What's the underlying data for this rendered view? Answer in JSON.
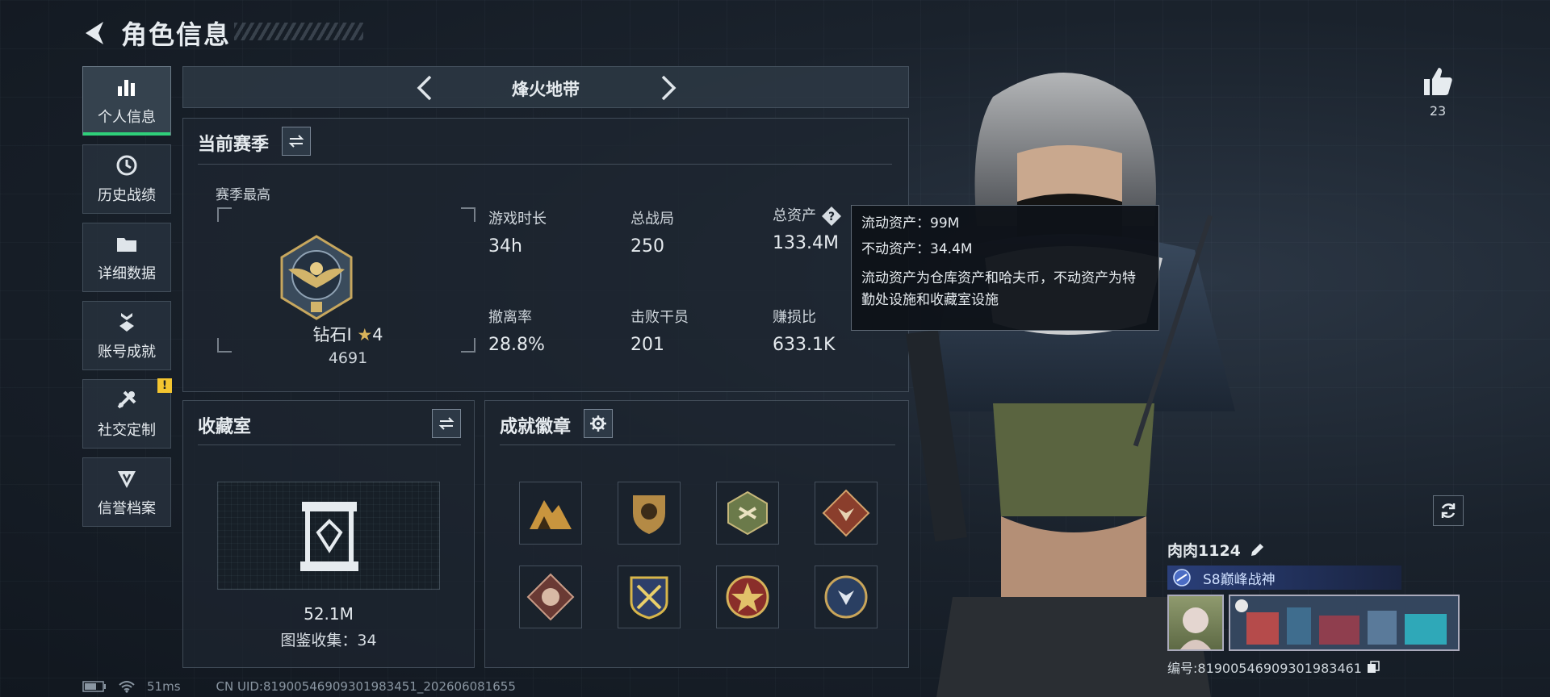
{
  "header": {
    "title": "角色信息"
  },
  "sidebar": {
    "items": [
      {
        "label": "个人信息",
        "icon": "bar-chart-icon",
        "active": true
      },
      {
        "label": "历史战绩",
        "icon": "history-icon"
      },
      {
        "label": "详细数据",
        "icon": "folder-icon"
      },
      {
        "label": "账号成就",
        "icon": "achievement-icon"
      },
      {
        "label": "社交定制",
        "icon": "tools-icon",
        "alert": "!"
      },
      {
        "label": "信誉档案",
        "icon": "shield-badge-icon"
      }
    ]
  },
  "mode": {
    "title": "烽火地带"
  },
  "season": {
    "title": "当前赛季",
    "best_label": "赛季最高",
    "rank_name": "钻石I",
    "rank_stars": "4",
    "rank_score": "4691",
    "stats": [
      {
        "label": "游戏时长",
        "value": "34h"
      },
      {
        "label": "总战局",
        "value": "250"
      },
      {
        "label": "总资产",
        "value": "133.4M"
      },
      {
        "label": "撤离率",
        "value": "28.8%"
      },
      {
        "label": "击败干员",
        "value": "201"
      },
      {
        "label": "赚损比",
        "value": "633.1K"
      }
    ]
  },
  "tooltip": {
    "liquid": "流动资产：99M",
    "fixed": "不动资产：34.4M",
    "desc": "流动资产为仓库资产和哈夫币，不动资产为特勤处设施和收藏室设施"
  },
  "collection": {
    "title": "收藏室",
    "value": "52.1M",
    "count": "图鉴收集：34"
  },
  "badges": {
    "title": "成就徽章"
  },
  "likes": {
    "count": "23"
  },
  "player": {
    "name": "肉肉1124",
    "title": "S8巅峰战神",
    "id": "编号:8190054690930198346​1"
  },
  "status": {
    "ping": "51ms",
    "uid": "CN UID:81900546909301983451_202606081655"
  },
  "colors": {
    "accent": "#2fd07a",
    "alert": "#f4c530"
  }
}
